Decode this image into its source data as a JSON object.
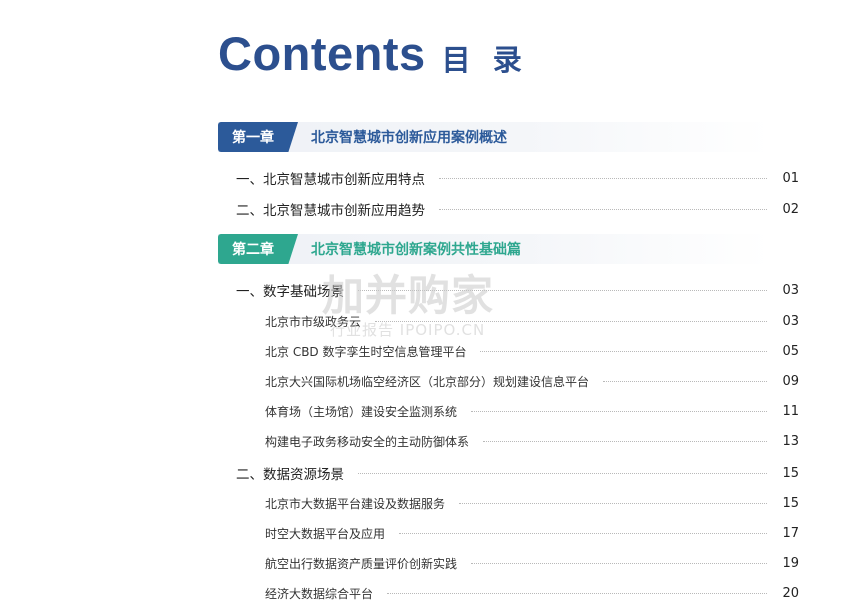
{
  "title": {
    "en": "Contents",
    "cn": "目 录"
  },
  "chapters": [
    {
      "tag": "第一章",
      "title": "北京智慧城市创新应用案例概述",
      "color": "#2c5a9a"
    },
    {
      "tag": "第二章",
      "title": "北京智慧城市创新案例共性基础篇",
      "color": "#2ea78f"
    }
  ],
  "entries": [
    {
      "label": "一、北京智慧城市创新应用特点",
      "page": "01"
    },
    {
      "label": "二、北京智慧城市创新应用趋势",
      "page": "02"
    },
    {
      "label": "一、数字基础场景",
      "page": "03"
    },
    {
      "label": "北京市市级政务云",
      "page": "03"
    },
    {
      "label": "北京 CBD 数字孪生时空信息管理平台",
      "page": "05"
    },
    {
      "label": "北京大兴国际机场临空经济区（北京部分）规划建设信息平台",
      "page": "09"
    },
    {
      "label": "体育场（主场馆）建设安全监测系统",
      "page": "11"
    },
    {
      "label": "构建电子政务移动安全的主动防御体系",
      "page": "13"
    },
    {
      "label": "二、数据资源场景",
      "page": "15"
    },
    {
      "label": "北京市大数据平台建设及数据服务",
      "page": "15"
    },
    {
      "label": "时空大数据平台及应用",
      "page": "17"
    },
    {
      "label": "航空出行数据资产质量评价创新实践",
      "page": "19"
    },
    {
      "label": "经济大数据综合平台",
      "page": "20"
    }
  ],
  "watermark": {
    "main": "加并购家",
    "sub": "行业报告 IPOIPO.CN"
  }
}
